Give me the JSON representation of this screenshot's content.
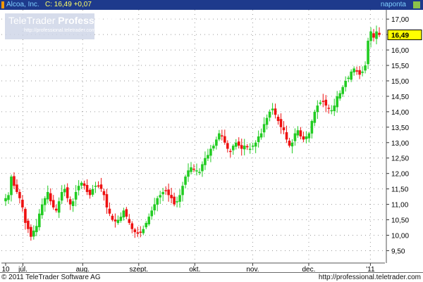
{
  "header": {
    "symbol": "Alcoa, Inc.",
    "price_text": "C: 16,49 +0,07",
    "frequency": "naponta"
  },
  "logo": {
    "title_light": "TeleTrader",
    "title_bold": "Professional",
    "url": "http://professional.teletrader.com/"
  },
  "footer": {
    "copyright": "© 2011 TeleTrader Software AG",
    "url": "http://professional.teletrader.com"
  },
  "colors": {
    "header_bg": "#1e3a8c",
    "up_candle": "#22cc22",
    "down_candle": "#ee1111",
    "last_price_box": "#ffff00"
  },
  "chart_data": {
    "type": "candlestick",
    "title": "Alcoa, Inc.",
    "last_price": "16,49",
    "y_ticks": [
      "9,50",
      "10,00",
      "10,50",
      "11,00",
      "11,50",
      "12,00",
      "12,50",
      "13,00",
      "13,50",
      "14,00",
      "14,50",
      "15,00",
      "15,50",
      "16,00",
      "16,50",
      "17,00"
    ],
    "y_tick_values": [
      9.5,
      10,
      10.5,
      11,
      11.5,
      12,
      12.5,
      13,
      13.5,
      14,
      14.5,
      15,
      15.5,
      16,
      16.5,
      17
    ],
    "ylim": [
      9.1,
      17.3
    ],
    "x_labels": [
      "10",
      "júl.",
      "aug.",
      "szept.",
      "okt.",
      "nov.",
      "dec.",
      "'11"
    ],
    "x_label_dates": [
      "2010-06-01",
      "2010-07-01",
      "2010-08-02",
      "2010-09-01",
      "2010-10-01",
      "2010-11-01",
      "2010-12-01",
      "2011-01-03"
    ],
    "grid": true,
    "series": [
      {
        "name": "Alcoa, Inc.",
        "closes": [
          11.2,
          11.3,
          11.9,
          11.6,
          11.4,
          11.2,
          10.9,
          10.4,
          10.2,
          9.95,
          10.15,
          10.3,
          10.7,
          11.0,
          11.2,
          11.4,
          11.1,
          10.9,
          10.8,
          11.1,
          11.4,
          11.5,
          11.2,
          11.0,
          11.1,
          11.4,
          11.6,
          11.7,
          11.6,
          11.4,
          11.3,
          11.5,
          11.6,
          11.6,
          11.5,
          11.3,
          10.9,
          10.7,
          10.5,
          10.45,
          10.5,
          10.6,
          10.8,
          10.6,
          10.4,
          10.2,
          10.1,
          10.05,
          10.1,
          10.2,
          10.4,
          10.6,
          10.8,
          11.0,
          11.2,
          11.3,
          11.4,
          11.45,
          11.3,
          11.2,
          11.0,
          11.1,
          11.3,
          11.6,
          11.9,
          12.1,
          12.2,
          12.15,
          12.1,
          12.05,
          12.3,
          12.5,
          12.6,
          12.8,
          12.9,
          13.1,
          13.3,
          13.2,
          13.0,
          12.8,
          12.7,
          12.9,
          13.0,
          12.9,
          12.8,
          12.9,
          12.85,
          12.8,
          12.9,
          13.0,
          13.2,
          13.3,
          13.6,
          13.8,
          14.0,
          14.1,
          13.9,
          13.7,
          13.5,
          13.4,
          13.1,
          12.9,
          13.0,
          13.3,
          13.4,
          13.2,
          13.1,
          13.2,
          13.3,
          13.7,
          14.0,
          14.2,
          14.3,
          14.35,
          14.2,
          14.1,
          14.05,
          14.2,
          14.5,
          14.6,
          14.8,
          15.0,
          15.1,
          15.3,
          15.4,
          15.3,
          15.2,
          15.3,
          15.5,
          16.3,
          16.6,
          16.4,
          16.6,
          16.49
        ]
      }
    ]
  }
}
